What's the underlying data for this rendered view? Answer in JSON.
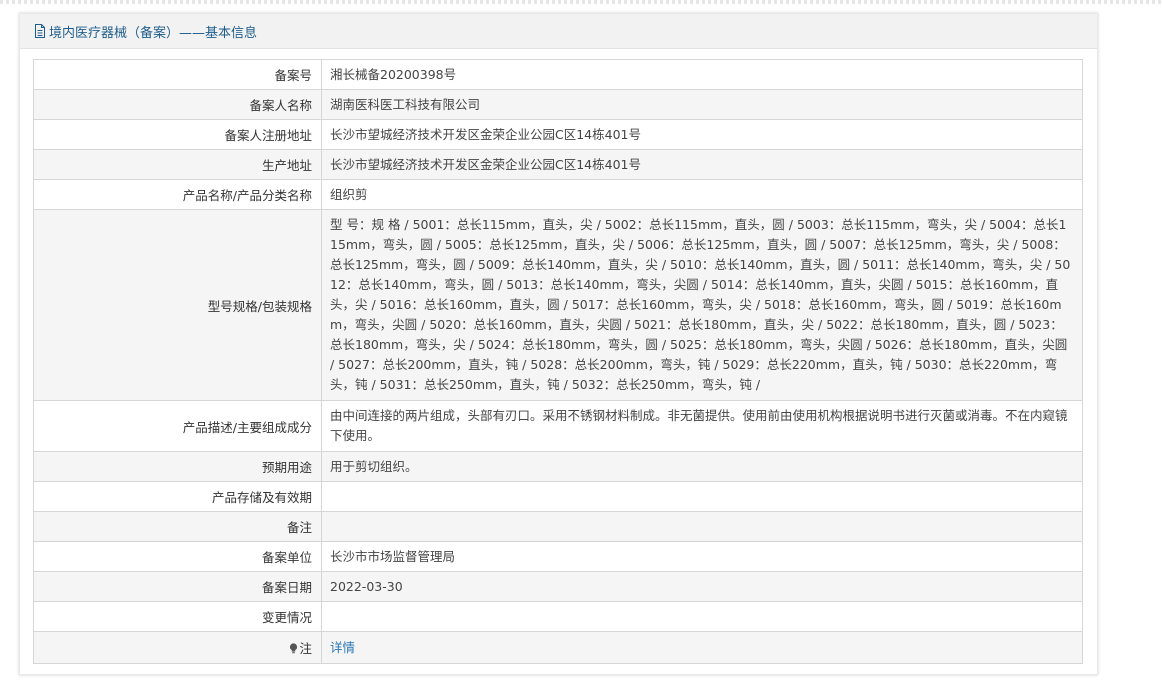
{
  "header": {
    "title": "境内医疗器械（备案）——基本信息"
  },
  "rows": {
    "record_no": {
      "label": "备案号",
      "value": "湘长械备20200398号"
    },
    "filer_name": {
      "label": "备案人名称",
      "value": "湖南医科医工科技有限公司"
    },
    "filer_address": {
      "label": "备案人注册地址",
      "value": "长沙市望城经济技术开发区金荣企业公园C区14栋401号"
    },
    "production_address": {
      "label": "生产地址",
      "value": "长沙市望城经济技术开发区金荣企业公园C区14栋401号"
    },
    "product_name": {
      "label": "产品名称/产品分类名称",
      "value": "组织剪"
    },
    "model_spec": {
      "label": "型号规格/包装规格",
      "value": "型 号：规 格 / 5001：总长115mm，直头，尖 / 5002：总长115mm，直头，圆 / 5003：总长115mm，弯头，尖 / 5004：总长115mm，弯头，圆 / 5005：总长125mm，直头，尖 / 5006：总长125mm，直头，圆 / 5007：总长125mm，弯头，尖 / 5008：总长125mm，弯头，圆 / 5009：总长140mm，直头，尖 / 5010：总长140mm，直头，圆 / 5011：总长140mm，弯头，尖 / 5012：总长140mm，弯头，圆 / 5013：总长140mm，弯头，尖圆 / 5014：总长140mm，直头，尖圆 / 5015：总长160mm，直头，尖 / 5016：总长160mm，直头，圆 / 5017：总长160mm，弯头，尖 / 5018：总长160mm，弯头，圆 / 5019：总长160mm，弯头，尖圆 / 5020：总长160mm，直头，尖圆 / 5021：总长180mm，直头，尖 / 5022：总长180mm，直头，圆 / 5023：总长180mm，弯头，尖 / 5024：总长180mm，弯头，圆 / 5025：总长180mm，弯头，尖圆 / 5026：总长180mm，直头，尖圆 / 5027：总长200mm，直头，钝 / 5028：总长200mm，弯头，钝 / 5029：总长220mm，直头，钝 / 5030：总长220mm，弯头，钝 / 5031：总长250mm，直头，钝 / 5032：总长250mm，弯头，钝 /"
    },
    "description": {
      "label": "产品描述/主要组成成分",
      "value": "由中间连接的两片组成，头部有刃口。采用不锈钢材料制成。非无菌提供。使用前由使用机构根据说明书进行灭菌或消毒。不在内窥镜下使用。"
    },
    "intended_use": {
      "label": "预期用途",
      "value": "用于剪切组织。"
    },
    "storage": {
      "label": "产品存储及有效期",
      "value": ""
    },
    "remarks": {
      "label": "备注",
      "value": ""
    },
    "record_unit": {
      "label": "备案单位",
      "value": "长沙市市场监督管理局"
    },
    "record_date": {
      "label": "备案日期",
      "value": "2022-03-30"
    },
    "changes": {
      "label": "变更情况",
      "value": ""
    },
    "note": {
      "label": "注",
      "link_text": "详情"
    }
  },
  "colors": {
    "header_text": "#1f5d8c",
    "link": "#2a76b8",
    "row_alt_bg": "#f5f5f5",
    "border": "#d6d6d6"
  },
  "icons": {
    "header": "document-icon",
    "note": "lightbulb-icon"
  }
}
